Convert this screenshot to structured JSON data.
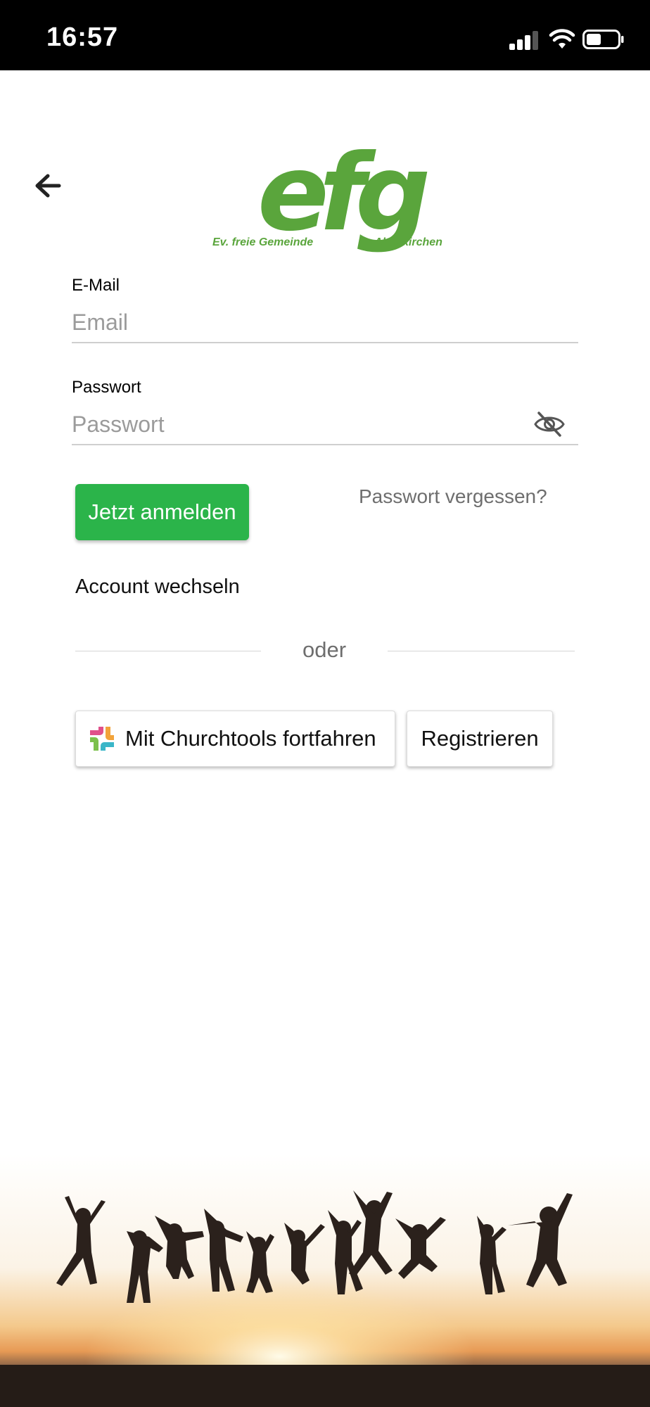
{
  "status_bar": {
    "time": "16:57",
    "icons": [
      "signal-icon",
      "wifi-icon",
      "battery-icon"
    ]
  },
  "header": {
    "back_icon": "arrow-left-icon",
    "logo": {
      "letters": "efg",
      "left_text": "Ev. freie Gemeinde",
      "right_text": "Altenkirchen",
      "color": "#5aa53c"
    }
  },
  "form": {
    "email": {
      "label": "E-Mail",
      "placeholder": "Email",
      "value": ""
    },
    "password": {
      "label": "Passwort",
      "placeholder": "Passwort",
      "value": "",
      "toggle_icon": "eye-off-icon"
    },
    "login_button": "Jetzt anmelden",
    "forgot_password": "Passwort vergessen?",
    "switch_account": "Account wechseln",
    "divider_text": "oder",
    "churchtools_button": "Mit Churchtools fortfahren",
    "register_button": "Registrieren"
  },
  "colors": {
    "accent": "#2bb44a",
    "logo": "#5aa53c",
    "muted_text": "#6e6e6e"
  },
  "background_image": "silhouettes-jumping-at-sunset"
}
